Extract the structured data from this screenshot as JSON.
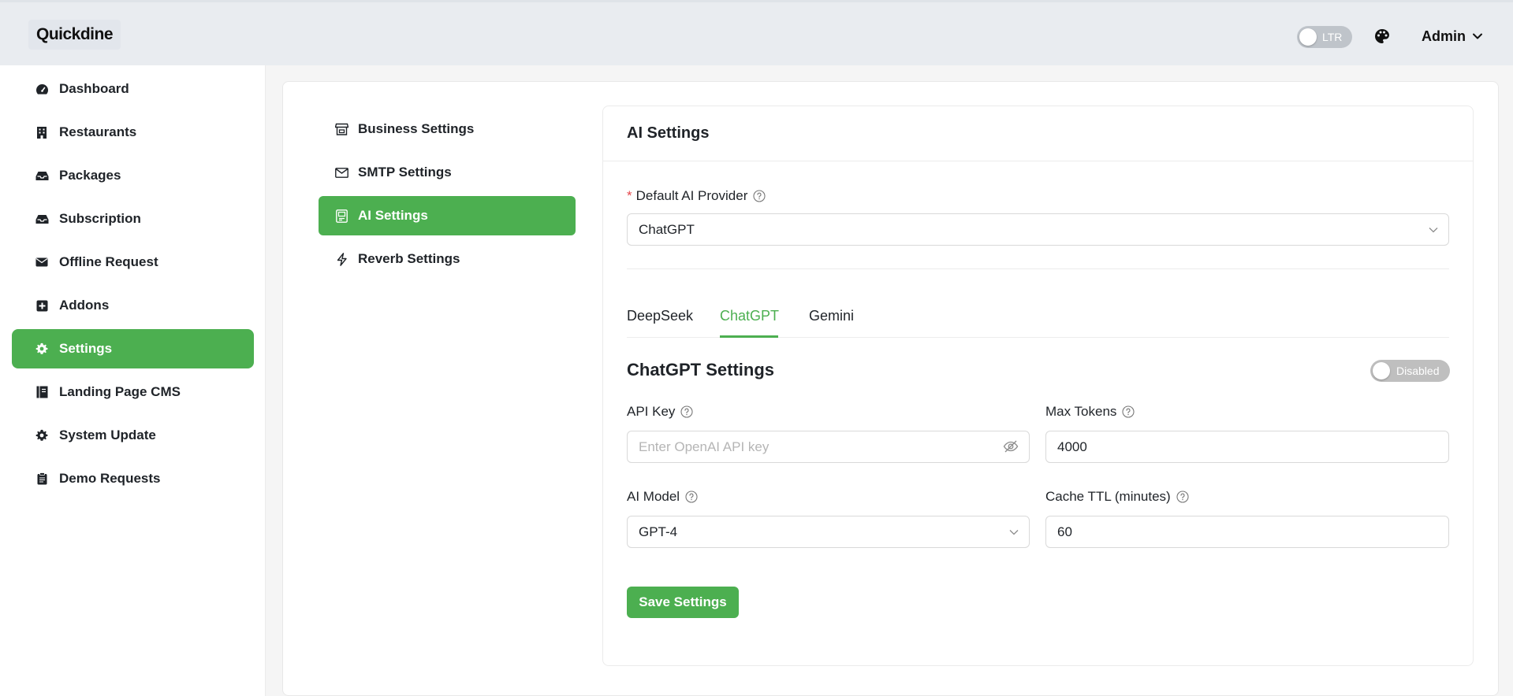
{
  "app": {
    "logo_text": "Quickdine"
  },
  "header": {
    "direction_toggle_label": "LTR",
    "user_menu_label": "Admin"
  },
  "sidebar": {
    "items": [
      {
        "label": "Dashboard",
        "icon": "dashboard-icon"
      },
      {
        "label": "Restaurants",
        "icon": "building-icon"
      },
      {
        "label": "Packages",
        "icon": "inbox-icon"
      },
      {
        "label": "Subscription",
        "icon": "inbox-icon"
      },
      {
        "label": "Offline Request",
        "icon": "envelope-icon"
      },
      {
        "label": "Addons",
        "icon": "plus-square-icon"
      },
      {
        "label": "Settings",
        "icon": "gear-icon",
        "active": true
      },
      {
        "label": "Landing Page CMS",
        "icon": "book-icon"
      },
      {
        "label": "System Update",
        "icon": "gear-icon"
      },
      {
        "label": "Demo Requests",
        "icon": "clipboard-icon"
      }
    ]
  },
  "settings_nav": {
    "items": [
      {
        "label": "Business Settings",
        "icon": "shop-icon"
      },
      {
        "label": "SMTP Settings",
        "icon": "mail-icon"
      },
      {
        "label": "AI Settings",
        "icon": "robot-icon",
        "active": true
      },
      {
        "label": "Reverb Settings",
        "icon": "lightning-icon"
      }
    ]
  },
  "ai_settings": {
    "title": "AI Settings",
    "default_provider": {
      "label": "Default AI Provider",
      "value": "ChatGPT"
    },
    "tabs": [
      {
        "label": "DeepSeek"
      },
      {
        "label": "ChatGPT",
        "active": true
      },
      {
        "label": "Gemini"
      }
    ],
    "section_title": "ChatGPT Settings",
    "status_toggle_label": "Disabled",
    "api_key": {
      "label": "API Key",
      "value": "",
      "placeholder": "Enter OpenAI API key"
    },
    "max_tokens": {
      "label": "Max Tokens",
      "value": "4000"
    },
    "ai_model": {
      "label": "AI Model",
      "value": "GPT-4"
    },
    "cache_ttl": {
      "label": "Cache TTL (minutes)",
      "value": "60"
    },
    "save_button_label": "Save Settings"
  },
  "colors": {
    "accent": "#4caf50",
    "required": "#e5484d"
  }
}
